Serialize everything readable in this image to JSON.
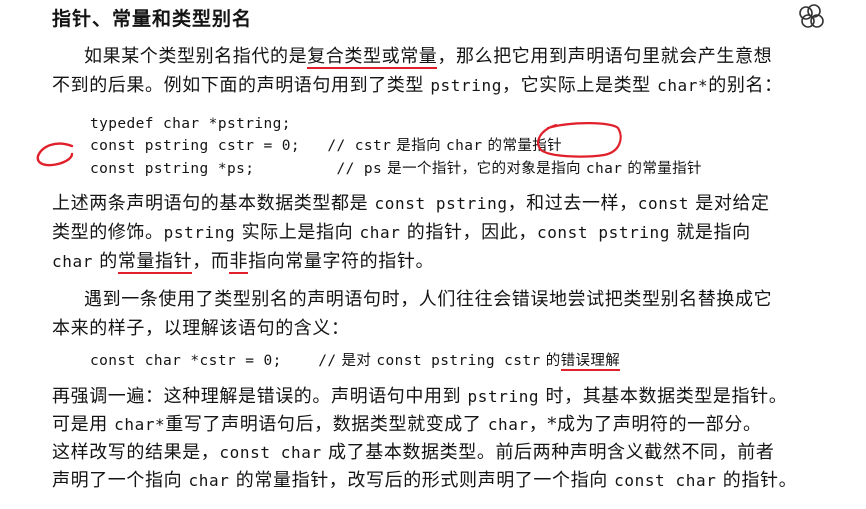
{
  "heading": "指针、常量和类型别名",
  "p1": {
    "l1_a": "如果某个类型别名指代的是",
    "l1_b": "复合类型或常量",
    "l1_c": "，那么把它用到声明语句里就会产生意想",
    "l2_a": "不到的后果。例如下面的声明语句用到了类型 ",
    "l2_b": "pstring",
    "l2_c": "，它实际上是类型 ",
    "l2_d": "char*",
    "l2_e": "的别名："
  },
  "code1": {
    "line1": "typedef char *pstring;",
    "line2_code": "const pstring cstr = 0;   // cstr",
    "line2_cmt_a": " 是指向 ",
    "line2_char": "char",
    "line2_cmt_b": " 的",
    "line2_hl": "常量指针",
    "line3_code": "const pstring *ps;         // ps",
    "line3_cmt_a": " 是一个指针，它的对象是指向 ",
    "line3_char": "char",
    "line3_cmt_b": " 的常量指针"
  },
  "p2": {
    "l1_a": "上述两条声明语句的基本数据类型都是 ",
    "l1_b": "const pstring",
    "l1_c": "，和过去一样，",
    "l1_d": "const",
    "l1_e": " 是对给定",
    "l2_a": "类型的修饰。",
    "l2_b": "pstring",
    "l2_c": " 实际上是指向 ",
    "l2_d": "char",
    "l2_e": " 的指针，因此，",
    "l2_f": "const pstring",
    "l2_g": " 就是指向",
    "l3_a": "char",
    "l3_b": " 的",
    "l3_c": "常量指针",
    "l3_d": "，而",
    "l3_e": "非",
    "l3_f": "指向常量字符的指针。"
  },
  "p3": {
    "l1": "遇到一条使用了类型别名的声明语句时，人们往往会错误地尝试把类型别名替换成它",
    "l2": "本来的样子，以理解该语句的含义："
  },
  "code2": {
    "code": "const char *cstr = 0;    //",
    "cmt_a": " 是对 ",
    "cmt_b": "const pstring cstr",
    "cmt_c": " 的",
    "hl": "错误理解"
  },
  "p4": {
    "l1_a": "再强调一遍：这种理解是错误的。声明语句中用到 ",
    "l1_b": "pstring",
    "l1_c": " 时，其基本数据类型是指针。",
    "l2_a": "可是用 ",
    "l2_b": "char*",
    "l2_c": "重写了声明语句后，数据类型就变成了 ",
    "l2_d": "char",
    "l2_e": "，*成为了声明符的一部分。",
    "l3_a": "这样改写的结果是，",
    "l3_b": "const char",
    "l3_c": " 成了基本数据类型。前后两种声明含义截然不同，前者",
    "l4_a": "声明了一个指向 ",
    "l4_b": "char",
    "l4_c": " 的常量指针，改写后的形式则声明了一个指向 ",
    "l4_d": "const char",
    "l4_e": " 的指针。"
  },
  "colors": {
    "annotation": "#e0202a",
    "text": "#141414"
  },
  "icons": [
    "margin-note-icon"
  ]
}
